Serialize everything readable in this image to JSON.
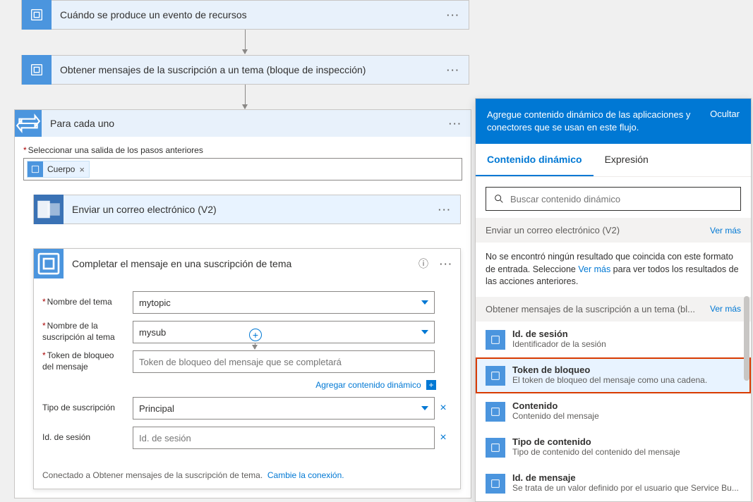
{
  "flow": {
    "trigger": {
      "title": "Cuándo se produce un evento de recursos"
    },
    "step2": {
      "title": "Obtener mensajes de la suscripción a un tema (bloque de inspección)"
    },
    "foreach": {
      "title": "Para cada uno",
      "select_label_prefix": "*",
      "select_label": "Seleccionar una salida de los pasos anteriores",
      "body_chip": "Cuerpo"
    },
    "send_email": {
      "title": "Enviar un correo electrónico (V2)"
    },
    "complete": {
      "title": "Completar el mensaje en una suscripción de tema",
      "topic_label": "Nombre del tema",
      "topic_value": "mytopic",
      "sub_label": "Nombre de la suscripción al tema",
      "sub_value": "mysub",
      "lock_label": "Token de bloqueo del mensaje",
      "lock_placeholder": "Token de bloqueo del mensaje que se completará",
      "add_dynamic": "Agregar contenido dinámico",
      "subtype_label": "Tipo de suscripción",
      "subtype_value": "Principal",
      "session_label": "Id. de sesión",
      "session_placeholder": "Id. de sesión",
      "footer_text": "Conectado a Obtener mensajes de la suscripción de tema.",
      "footer_link": "Cambie la conexión."
    }
  },
  "dc": {
    "header_text": "Agregue contenido dinámico de las aplicaciones y conectores que se usan en este flujo.",
    "hide": "Ocultar",
    "tab_dynamic": "Contenido dinámico",
    "tab_expr": "Expresión",
    "search_placeholder": "Buscar contenido dinámico",
    "see_more": "Ver más",
    "section1": {
      "title": "Enviar un correo electrónico (V2)",
      "empty_pre": "No se encontró ningún resultado que coincida con este formato de entrada. Seleccione ",
      "empty_link": "Ver más",
      "empty_post": " para ver todos los resultados de las acciones anteriores."
    },
    "section2": {
      "title": "Obtener mensajes de la suscripción a un tema (bl...",
      "items": [
        {
          "t": "Id. de sesión",
          "d": "Identificador de la sesión"
        },
        {
          "t": "Token de bloqueo",
          "d": "El token de bloqueo del mensaje como una cadena."
        },
        {
          "t": "Contenido",
          "d": "Contenido del mensaje"
        },
        {
          "t": "Tipo de contenido",
          "d": "Tipo de contenido del contenido del mensaje"
        },
        {
          "t": "Id. de mensaje",
          "d": "Se trata de un valor definido por el usuario que Service Bu..."
        }
      ]
    }
  }
}
